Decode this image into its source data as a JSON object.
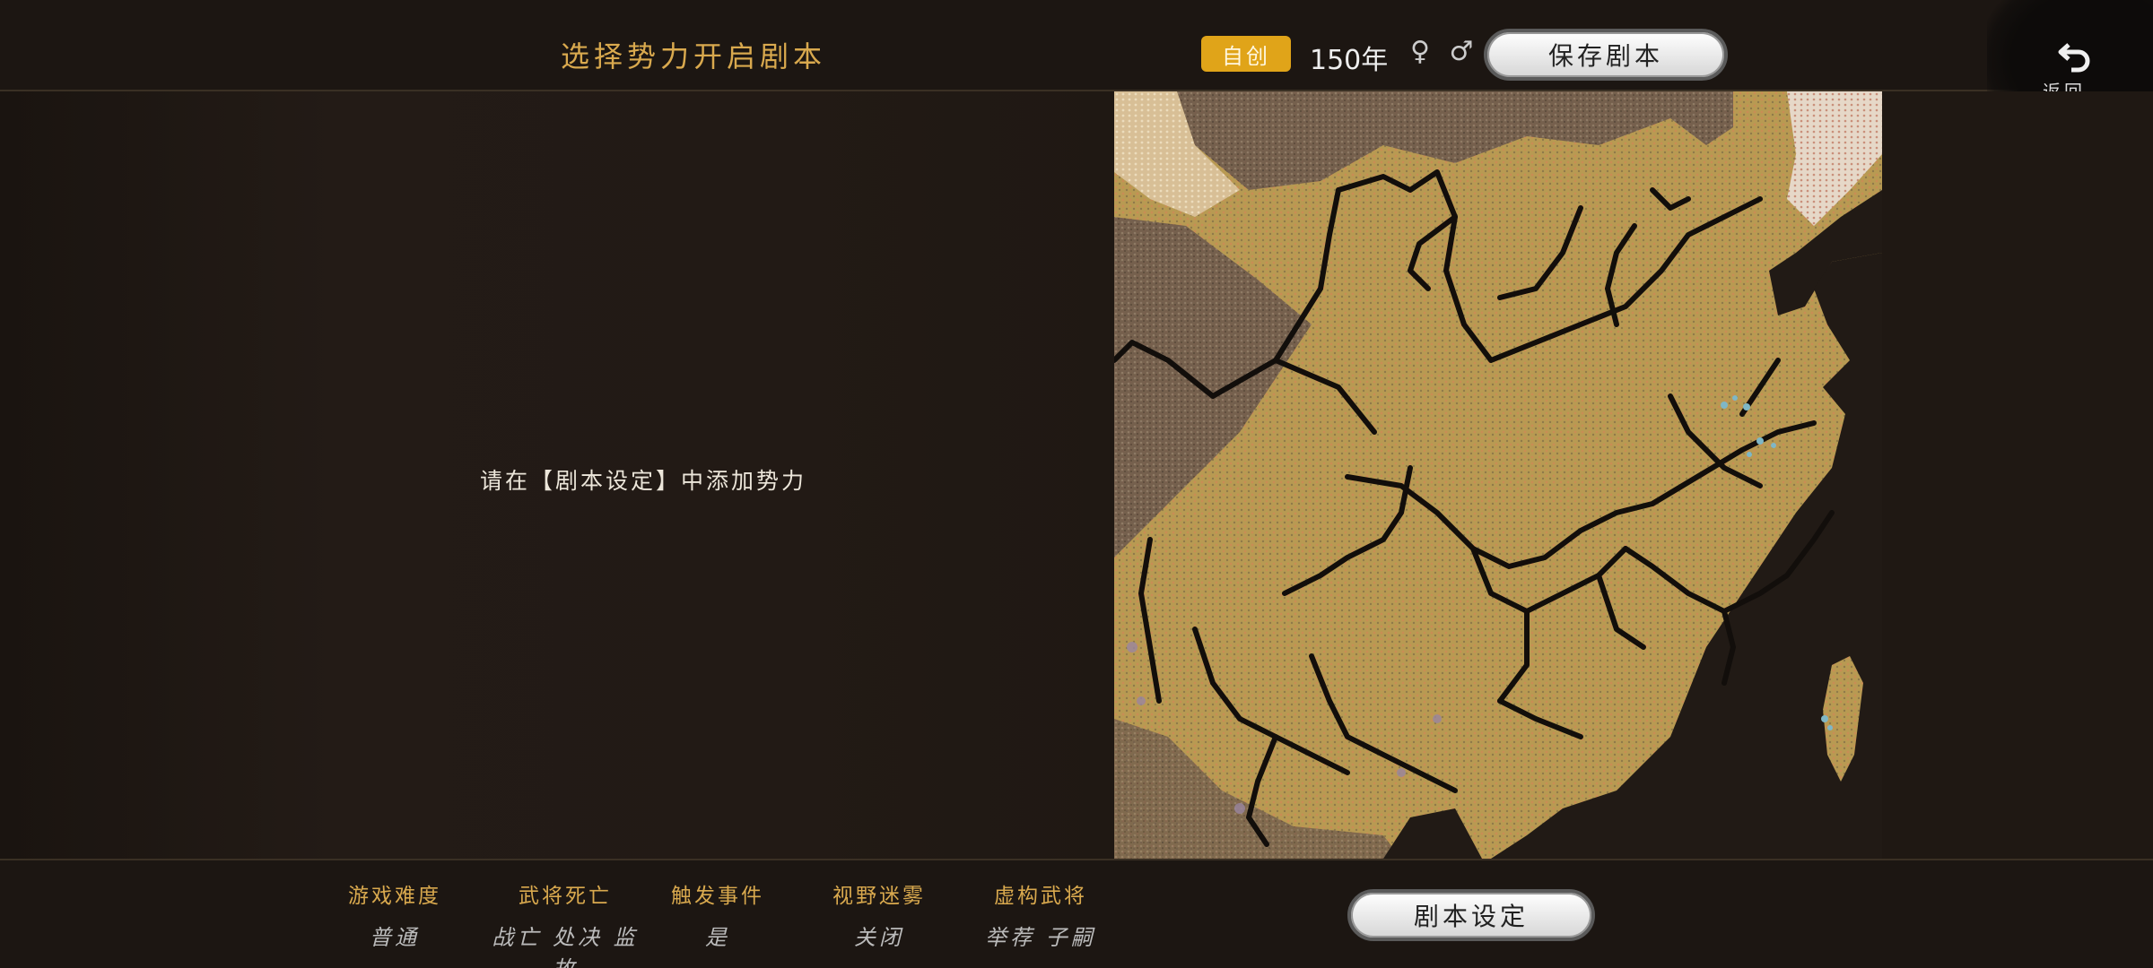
{
  "header": {
    "title": "选择势力开启剧本",
    "badge": "自创",
    "year": "150年",
    "gender_icons": "♀ ♂",
    "save_label": "保存剧本",
    "back_label": "返回"
  },
  "main": {
    "hint": "请在【剧本设定】中添加势力"
  },
  "settings": [
    {
      "label": "游戏难度",
      "value": "普通"
    },
    {
      "label": "武将死亡",
      "value": "战亡 处决 监故"
    },
    {
      "label": "触发事件",
      "value": "是"
    },
    {
      "label": "视野迷雾",
      "value": "关闭"
    },
    {
      "label": "虚构武将",
      "value": "举荐 子嗣"
    }
  ],
  "footer": {
    "scenario_button": "剧本设定"
  },
  "colors": {
    "accent_gold": "#d9a94e",
    "badge_bg": "#e0a419",
    "background": "#1e1814"
  },
  "icons": {
    "back": "undo-arrow-icon",
    "gender": "gender-symbols-icon"
  }
}
